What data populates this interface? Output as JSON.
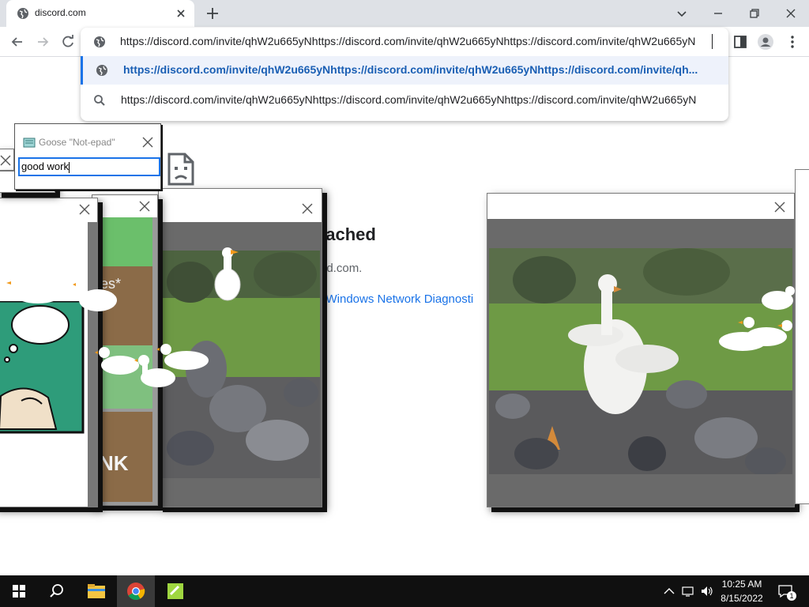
{
  "browser": {
    "tab_title": "discord.com",
    "omnibox_value": "https://discord.com/invite/qhW2u665yNhttps://discord.com/invite/qhW2u665yNhttps://discord.com/invite/qhW2u665yN",
    "suggestions": [
      {
        "text": "https://discord.com/invite/qhW2u665yNhttps://discord.com/invite/qhW2u665yNhttps://discord.com/invite/qh...",
        "icon": "globe-icon",
        "selected": true
      },
      {
        "text": "https://discord.com/invite/qhW2u665yNhttps://discord.com/invite/qhW2u665yNhttps://discord.com/invite/qhW2u665yN",
        "icon": "search-icon",
        "selected": false
      }
    ]
  },
  "error_page": {
    "title_fragment": "eached",
    "subtitle_fragment": "ord.com.",
    "link_fragment": "g Windows Network Diagnosti"
  },
  "notepad": {
    "title": "Goose \"Not-epad\"",
    "text": "good work"
  },
  "meme_fragments": {
    "left_text": "es*",
    "left_bottom": "NK"
  },
  "taskbar": {
    "time": "10:25 AM",
    "date": "8/15/2022",
    "notification_count": "1"
  },
  "colors": {
    "accent": "#1a73e8",
    "taskbar": "#101010",
    "tabstrip": "#dee1e6"
  }
}
